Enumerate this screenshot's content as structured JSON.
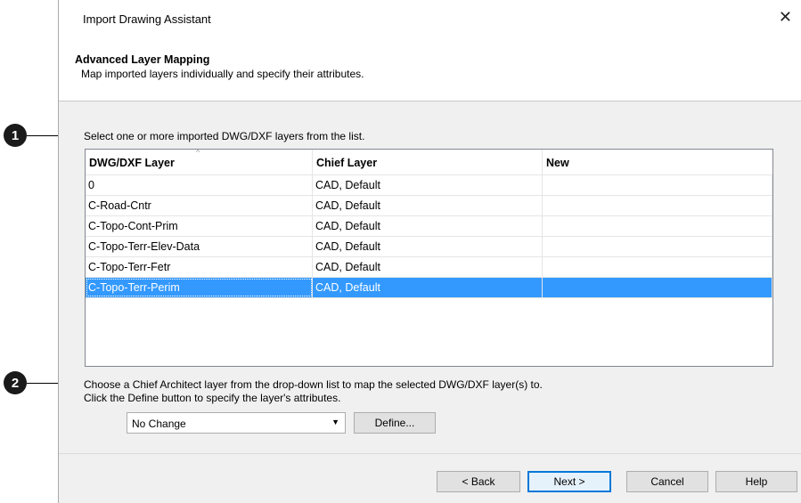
{
  "callouts": [
    "1",
    "2"
  ],
  "dialog": {
    "title": "Import Drawing Assistant",
    "close_glyph": "✕"
  },
  "section": {
    "title": "Advanced Layer Mapping",
    "description": "Map imported layers individually and specify their attributes."
  },
  "instructions": {
    "select": "Select one or more imported DWG/DXF layers from the list.",
    "choose_line1": "Choose a Chief Architect layer from the drop-down list to map the selected DWG/DXF layer(s) to.",
    "choose_line2": "Click the Define button to specify the layer's attributes."
  },
  "table": {
    "columns": [
      "DWG/DXF Layer",
      "Chief Layer",
      "New"
    ],
    "sort_indicator": "^",
    "rows": [
      {
        "dwg": "0",
        "chief": "CAD,  Default",
        "new": ""
      },
      {
        "dwg": "C-Road-Cntr",
        "chief": "CAD,  Default",
        "new": ""
      },
      {
        "dwg": "C-Topo-Cont-Prim",
        "chief": "CAD,  Default",
        "new": ""
      },
      {
        "dwg": "C-Topo-Terr-Elev-Data",
        "chief": "CAD,  Default",
        "new": ""
      },
      {
        "dwg": "C-Topo-Terr-Fetr",
        "chief": "CAD,  Default",
        "new": ""
      },
      {
        "dwg": "C-Topo-Terr-Perim",
        "chief": "CAD,  Default",
        "new": ""
      }
    ],
    "selected_row": 5
  },
  "layer_select": {
    "value": "No Change",
    "arrow_glyph": "▼"
  },
  "buttons": {
    "define": "Define...",
    "back": "< Back",
    "next": "Next >",
    "cancel": "Cancel",
    "help": "Help"
  },
  "colors": {
    "selection": "#3399ff",
    "dialog_bg": "#f0f0f0",
    "default_button_border": "#0078d7"
  }
}
